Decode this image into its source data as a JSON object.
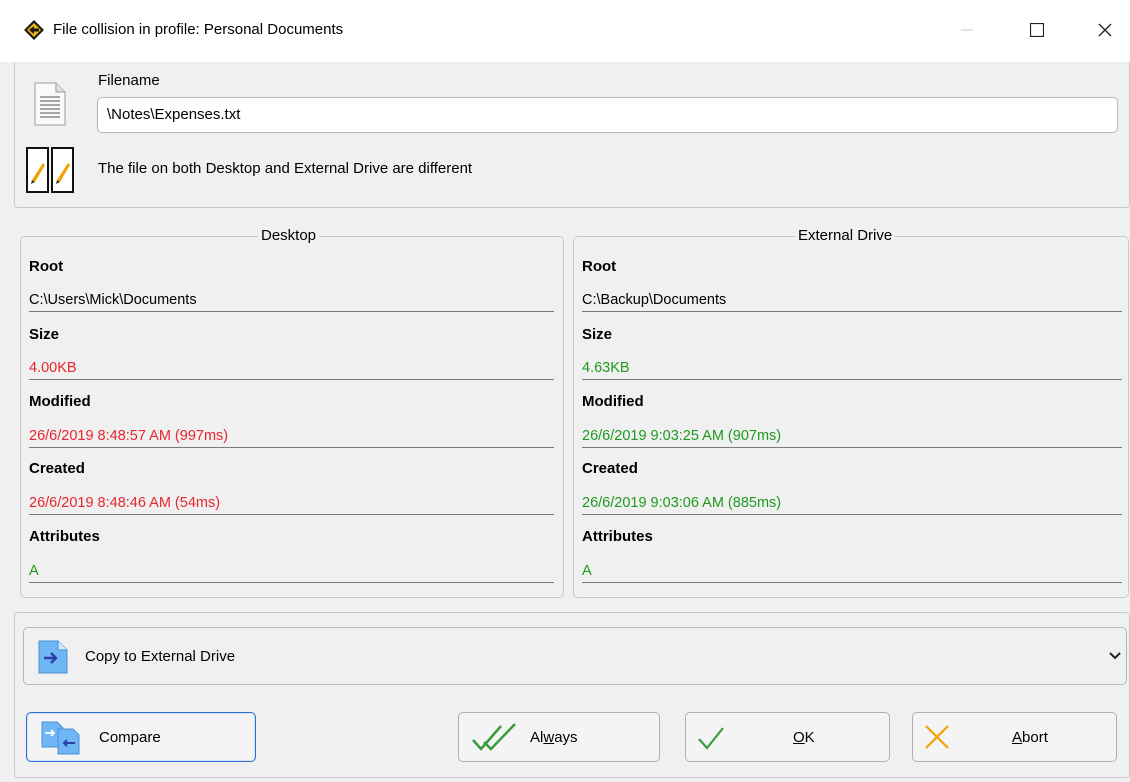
{
  "window": {
    "title": "File collision in profile: Personal Documents",
    "icon": "sync-app-icon"
  },
  "file": {
    "filename_label": "Filename",
    "filename_value": "\\Notes\\Expenses.txt",
    "difference_text": "The file on both Desktop and External Drive are different"
  },
  "desktop": {
    "title": "Desktop",
    "root_label": "Root",
    "root_value": "C:\\Users\\Mick\\Documents",
    "size_label": "Size",
    "size_value": "4.00KB",
    "modified_label": "Modified",
    "modified_value": "26/6/2019 8:48:57 AM (997ms)",
    "created_label": "Created",
    "created_value": "26/6/2019 8:48:46 AM (54ms)",
    "attributes_label": "Attributes",
    "attributes_value": "A"
  },
  "external": {
    "title": "External Drive",
    "root_label": "Root",
    "root_value": "C:\\Backup\\Documents",
    "size_label": "Size",
    "size_value": "4.63KB",
    "modified_label": "Modified",
    "modified_value": "26/6/2019 9:03:25 AM (907ms)",
    "created_label": "Created",
    "created_value": "26/6/2019 9:03:06 AM (885ms)",
    "attributes_label": "Attributes",
    "attributes_value": "A"
  },
  "action": {
    "selected": "Copy to External Drive"
  },
  "buttons": {
    "compare": "Compare",
    "always_pre": "Al",
    "always_ul": "w",
    "always_post": "ays",
    "ok_ul": "O",
    "ok_post": "K",
    "abort_ul": "A",
    "abort_post": "bort"
  },
  "colors": {
    "older": "#e8262c",
    "newer": "#1f9a1f",
    "focus": "#2d72d2"
  }
}
